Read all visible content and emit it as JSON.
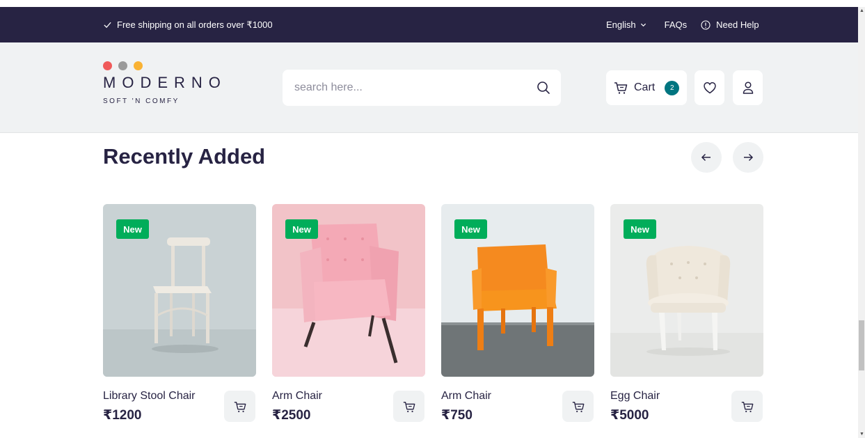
{
  "topbar": {
    "promo": "Free shipping on all orders over ₹1000",
    "language": "English",
    "faqs": "FAQs",
    "help": "Need Help",
    "bg_color": "#272343"
  },
  "logo": {
    "name": "MODERNO",
    "tagline": "SOFT 'N COMFY",
    "dot_colors": [
      "#f05a5a",
      "#9a9a9a",
      "#f9b233"
    ]
  },
  "search": {
    "placeholder": "search here..."
  },
  "cart": {
    "label": "Cart",
    "count": "2",
    "badge_color": "#007580"
  },
  "section": {
    "title": "Recently Added"
  },
  "products": [
    {
      "name": "Library Stool Chair",
      "price": "₹1200",
      "badge": "New"
    },
    {
      "name": "Arm Chair",
      "price": "₹2500",
      "badge": "New"
    },
    {
      "name": "Arm Chair",
      "price": "₹750",
      "badge": "New"
    },
    {
      "name": "Egg Chair",
      "price": "₹5000",
      "badge": "New"
    }
  ],
  "colors": {
    "new_badge": "#01ad5a",
    "light_bg": "#f0f2f3"
  }
}
